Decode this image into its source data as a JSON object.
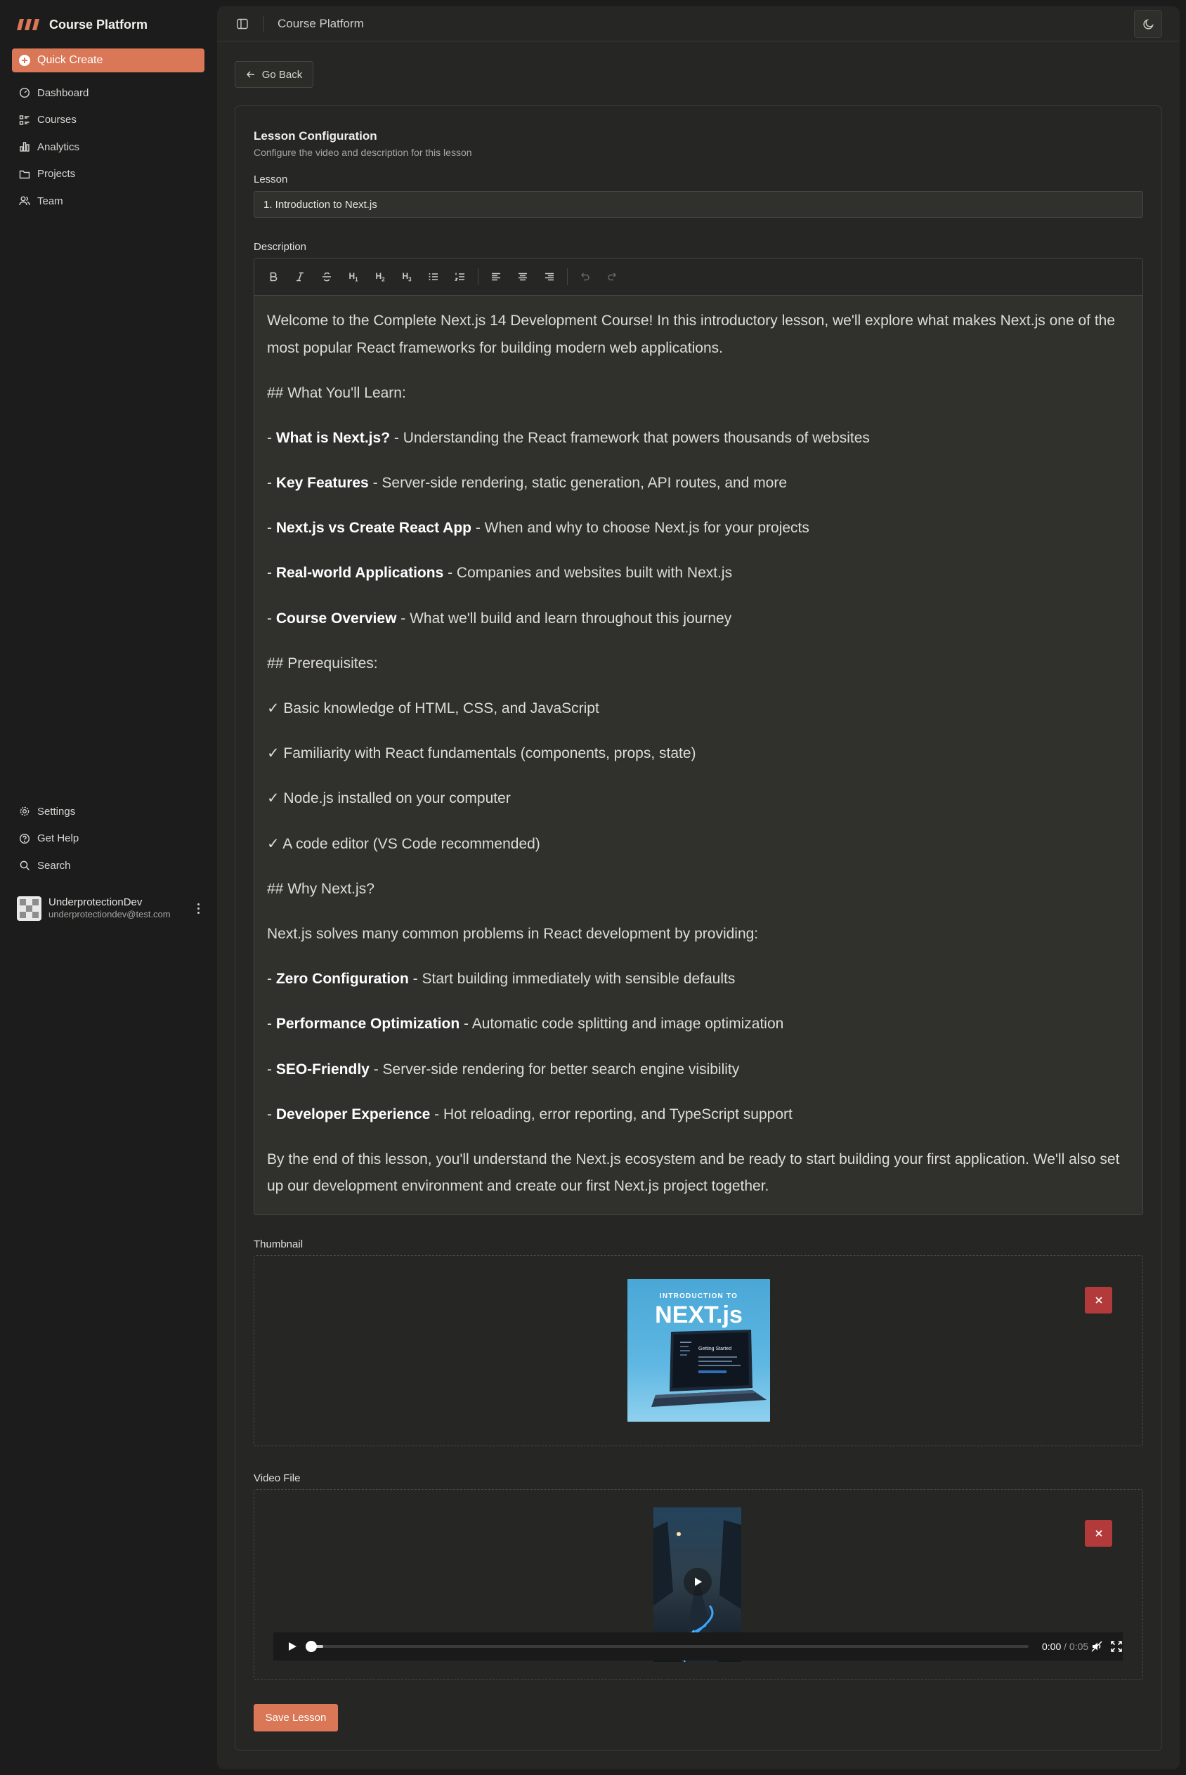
{
  "app": {
    "brand": "Course Platform",
    "accent_color": "#d97757",
    "danger_color": "#b33a3a"
  },
  "sidebar": {
    "quick_create": "Quick Create",
    "items": [
      {
        "label": "Dashboard",
        "icon": "dashboard-icon"
      },
      {
        "label": "Courses",
        "icon": "list-icon"
      },
      {
        "label": "Analytics",
        "icon": "bar-chart-icon"
      },
      {
        "label": "Projects",
        "icon": "folder-icon"
      },
      {
        "label": "Team",
        "icon": "users-icon"
      }
    ],
    "secondary_items": [
      {
        "label": "Settings",
        "icon": "gear-icon"
      },
      {
        "label": "Get Help",
        "icon": "help-circle-icon"
      },
      {
        "label": "Search",
        "icon": "search-icon"
      }
    ],
    "user": {
      "name": "UnderprotectionDev",
      "email": "underprotectiondev@test.com"
    }
  },
  "header": {
    "title": "Course Platform"
  },
  "page": {
    "go_back": "Go Back",
    "card_title": "Lesson Configuration",
    "card_subtitle": "Configure the video and description for this lesson",
    "lesson_label": "Lesson",
    "lesson_value": "1. Introduction to Next.js",
    "description_label": "Description",
    "thumbnail_label": "Thumbnail",
    "video_label": "Video File",
    "save_button": "Save Lesson"
  },
  "editor": {
    "toolbar": [
      "bold",
      "italic",
      "strikethrough",
      "heading-1",
      "heading-2",
      "heading-3",
      "bullet-list",
      "ordered-list",
      "align-left",
      "align-center",
      "align-right",
      "undo",
      "redo"
    ],
    "paragraphs": [
      {
        "plain": "Welcome to the Complete Next.js 14 Development Course! In this introductory lesson, we'll explore what makes Next.js one of the most popular React frameworks for building modern web applications."
      },
      {
        "plain": "## What You'll Learn:"
      },
      {
        "prefix": "- ",
        "bold": "What is Next.js?",
        "rest": " - Understanding the React framework that powers thousands of websites"
      },
      {
        "prefix": "- ",
        "bold": "Key Features",
        "rest": " - Server-side rendering, static generation, API routes, and more"
      },
      {
        "prefix": "- ",
        "bold": "Next.js vs Create React App",
        "rest": " - When and why to choose Next.js for your projects"
      },
      {
        "prefix": "- ",
        "bold": "Real-world Applications",
        "rest": " - Companies and websites built with Next.js"
      },
      {
        "prefix": "- ",
        "bold": "Course Overview",
        "rest": " - What we'll build and learn throughout this journey"
      },
      {
        "plain": "## Prerequisites:"
      },
      {
        "plain": "✓ Basic knowledge of HTML, CSS, and JavaScript"
      },
      {
        "plain": "✓ Familiarity with React fundamentals (components, props, state)"
      },
      {
        "plain": "✓ Node.js installed on your computer"
      },
      {
        "plain": "✓ A code editor (VS Code recommended)"
      },
      {
        "plain": "## Why Next.js?"
      },
      {
        "plain": "Next.js solves many common problems in React development by providing:"
      },
      {
        "prefix": "- ",
        "bold": "Zero Configuration",
        "rest": " - Start building immediately with sensible defaults"
      },
      {
        "prefix": "- ",
        "bold": "Performance Optimization",
        "rest": " - Automatic code splitting and image optimization"
      },
      {
        "prefix": "- ",
        "bold": "SEO-Friendly",
        "rest": " - Server-side rendering for better search engine visibility"
      },
      {
        "prefix": "- ",
        "bold": "Developer Experience",
        "rest": " - Hot reloading, error reporting, and TypeScript support"
      },
      {
        "plain": "By the end of this lesson, you'll understand the Next.js ecosystem and be ready to start building your first application. We'll also set up our development environment and create our first Next.js project together."
      }
    ]
  },
  "thumbnail": {
    "kicker": "INTRODUCTION TO",
    "headline": "NEXT.js",
    "screen_text": "Getting Started"
  },
  "video": {
    "current_time": "0:00",
    "separator": "/",
    "duration": "0:05",
    "progress": 0.0
  }
}
